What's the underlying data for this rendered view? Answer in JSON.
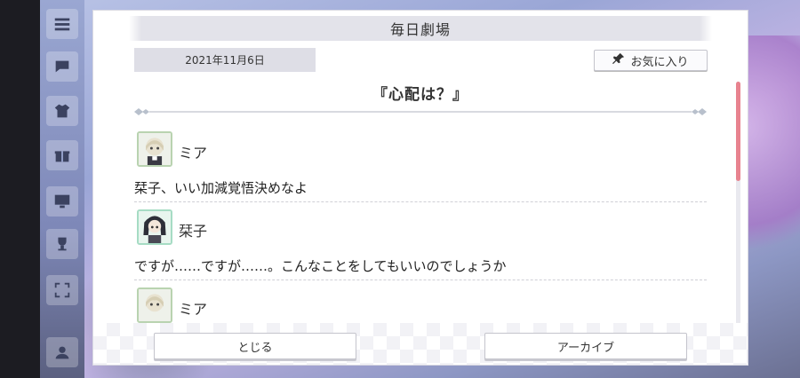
{
  "dialog": {
    "title": "毎日劇場",
    "date": "2021年11月6日",
    "favorite_label": "お気に入り",
    "story_title": "『心配は？』",
    "entries": [
      {
        "speaker": "ミア",
        "line": "栞子、いい加減覚悟決めなよ",
        "avatar": "mia-avatar"
      },
      {
        "speaker": "栞子",
        "line": "ですが……ですが……。こんなことをしてもいいのでしょうか",
        "avatar": "shioriko-avatar"
      },
      {
        "speaker": "ミア",
        "line": "",
        "avatar": "mia-avatar"
      }
    ],
    "buttons": {
      "close": "とじる",
      "archive": "アーカイブ"
    }
  },
  "colors": {
    "scroll_thumb": "#e8838f",
    "title_bar": "#e3e3ea",
    "date_box": "#dedee6"
  }
}
